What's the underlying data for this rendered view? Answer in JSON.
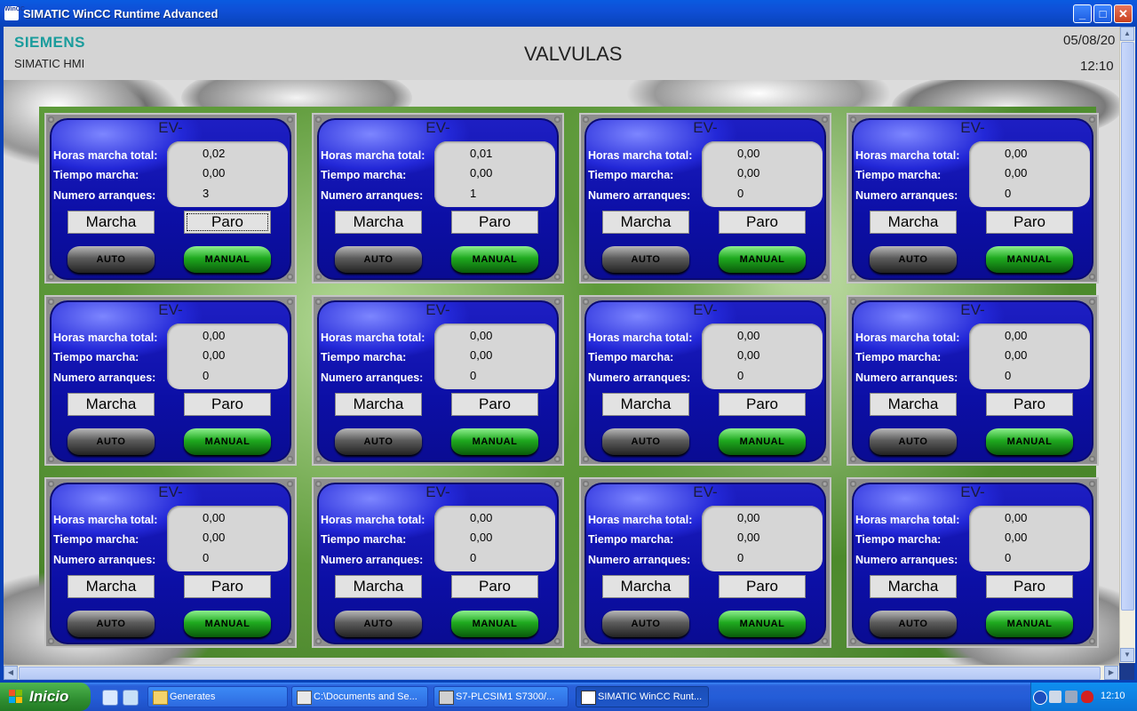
{
  "window": {
    "icon_text": "WinCC",
    "title": "SIMATIC WinCC Runtime Advanced",
    "buttons": [
      "minimize",
      "maximize",
      "close"
    ]
  },
  "header": {
    "brand": "SIEMENS",
    "subtitle": "SIMATIC HMI",
    "screen_title": "VALVULAS",
    "date": "05/08/20",
    "time": "12:10"
  },
  "labels": {
    "ev": "EV-",
    "horas": "Horas marcha total:",
    "tiempo": "Tiempo marcha:",
    "numero": "Numero arranques:",
    "marcha": "Marcha",
    "paro": "Paro",
    "auto": "AUTO",
    "manual": "MANUAL"
  },
  "valves": [
    {
      "horas": "0,02",
      "tiempo": "0,00",
      "arranques": "3"
    },
    {
      "horas": "0,01",
      "tiempo": "0,00",
      "arranques": "1"
    },
    {
      "horas": "0,00",
      "tiempo": "0,00",
      "arranques": "0"
    },
    {
      "horas": "0,00",
      "tiempo": "0,00",
      "arranques": "0"
    },
    {
      "horas": "0,00",
      "tiempo": "0,00",
      "arranques": "0"
    },
    {
      "horas": "0,00",
      "tiempo": "0,00",
      "arranques": "0"
    },
    {
      "horas": "0,00",
      "tiempo": "0,00",
      "arranques": "0"
    },
    {
      "horas": "0,00",
      "tiempo": "0,00",
      "arranques": "0"
    },
    {
      "horas": "0,00",
      "tiempo": "0,00",
      "arranques": "0"
    },
    {
      "horas": "0,00",
      "tiempo": "0,00",
      "arranques": "0"
    },
    {
      "horas": "0,00",
      "tiempo": "0,00",
      "arranques": "0"
    },
    {
      "horas": "0,00",
      "tiempo": "0,00",
      "arranques": "0"
    }
  ],
  "taskbar": {
    "start_label": "Inicio",
    "tasks": [
      {
        "label": "Generates",
        "icon": "folder-icon"
      },
      {
        "label": "C:\\Documents and Se...",
        "icon": "tia-portal-icon"
      },
      {
        "label": "S7-PLCSIM1    S7300/...",
        "icon": "plcsim-icon"
      },
      {
        "label": "SIMATIC WinCC Runt...",
        "icon": "wincc-icon"
      }
    ],
    "clock": "12:10"
  },
  "colors": {
    "panel_blue": "#1416b8",
    "manual_green": "#1faa1f",
    "siemens_teal": "#1a9c9c"
  }
}
